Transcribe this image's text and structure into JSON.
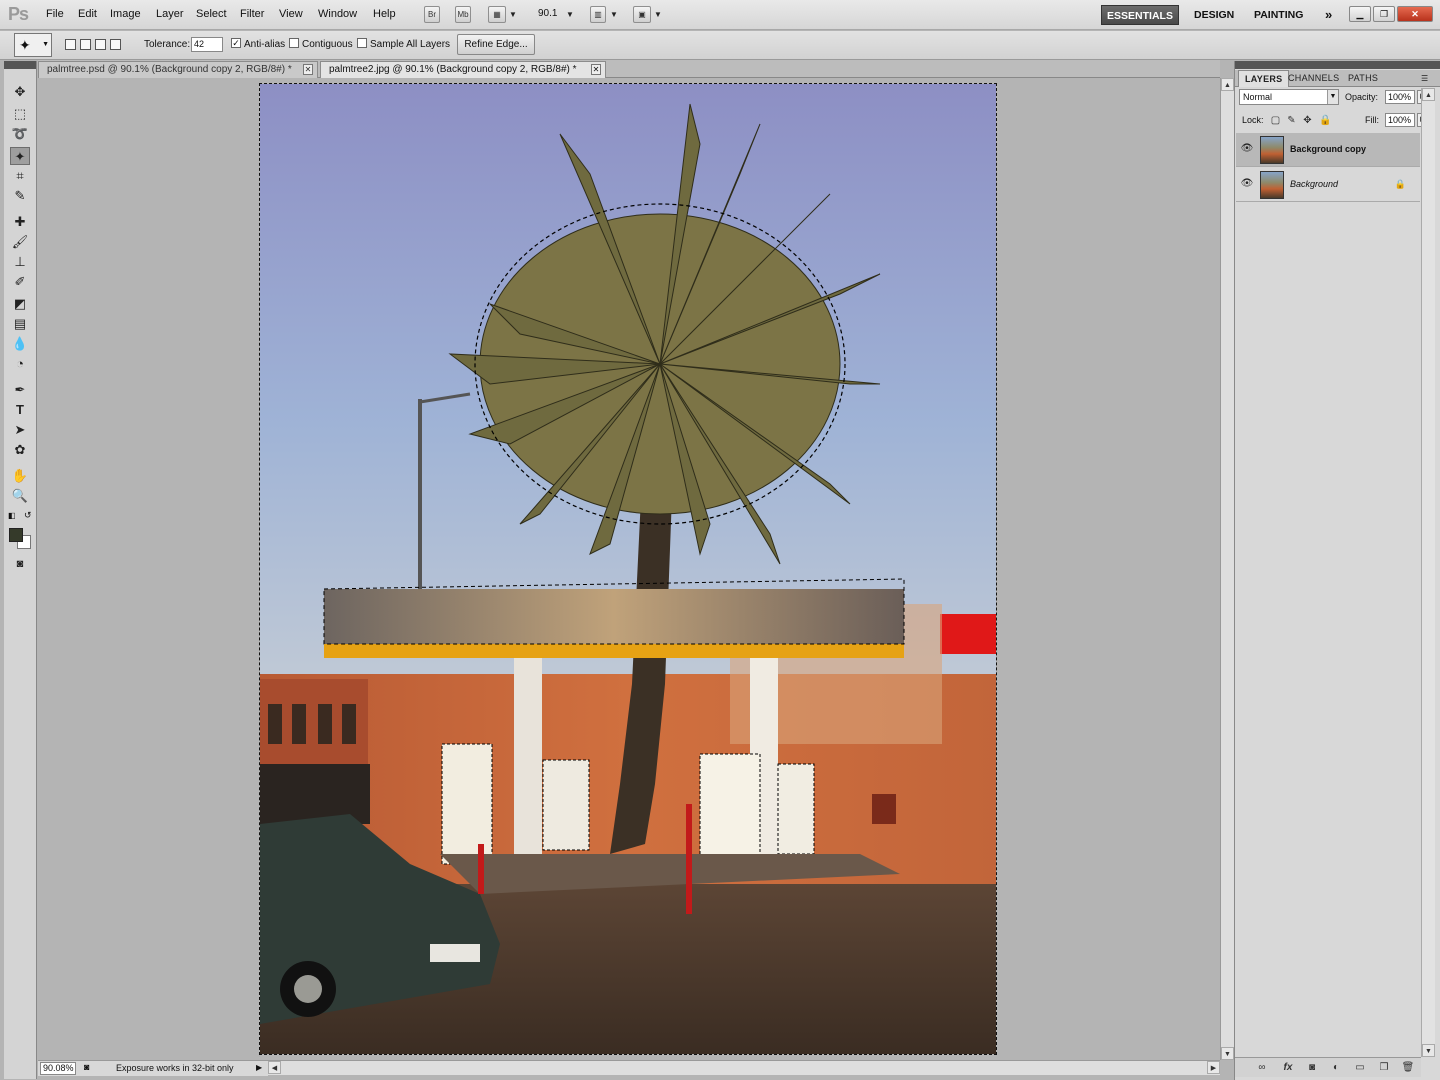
{
  "app": {
    "logo": "Ps",
    "menu": [
      "File",
      "Edit",
      "Image",
      "Layer",
      "Select",
      "Filter",
      "View",
      "Window",
      "Help"
    ],
    "bridge": "Br",
    "mini_bridge": "Mb",
    "zoom": "90.1",
    "workspaces": [
      "ESSENTIALS",
      "DESIGN",
      "PAINTING"
    ],
    "more": "»"
  },
  "options": {
    "tolerance_label": "Tolerance:",
    "tolerance_value": "42",
    "antialias_label": "Anti-alias",
    "antialias_checked": true,
    "contiguous_label": "Contiguous",
    "contiguous_checked": false,
    "sample_all_label": "Sample All Layers",
    "sample_all_checked": false,
    "refine_edge_label": "Refine Edge..."
  },
  "tabs": [
    {
      "label": "palmtree.psd @ 90.1% (Background copy 2, RGB/8#) *",
      "active": false
    },
    {
      "label": "palmtree2.jpg @ 90.1% (Background copy 2, RGB/8#) *",
      "active": true
    }
  ],
  "status": {
    "zoom": "90.08%",
    "text": "Exposure works in 32-bit only"
  },
  "panels": {
    "tabs": [
      "LAYERS",
      "CHANNELS",
      "PATHS"
    ],
    "blend_mode": "Normal",
    "opacity_label": "Opacity:",
    "opacity_value": "100%",
    "lock_label": "Lock:",
    "fill_label": "Fill:",
    "fill_value": "100%",
    "layers": [
      {
        "name": "Background copy",
        "visible": true,
        "selected": true
      },
      {
        "name": "Background",
        "visible": true,
        "locked": true
      }
    ]
  },
  "colors": {
    "foreground": "#353a2a",
    "background": "#ffffff",
    "workspace_active": "#555555"
  }
}
